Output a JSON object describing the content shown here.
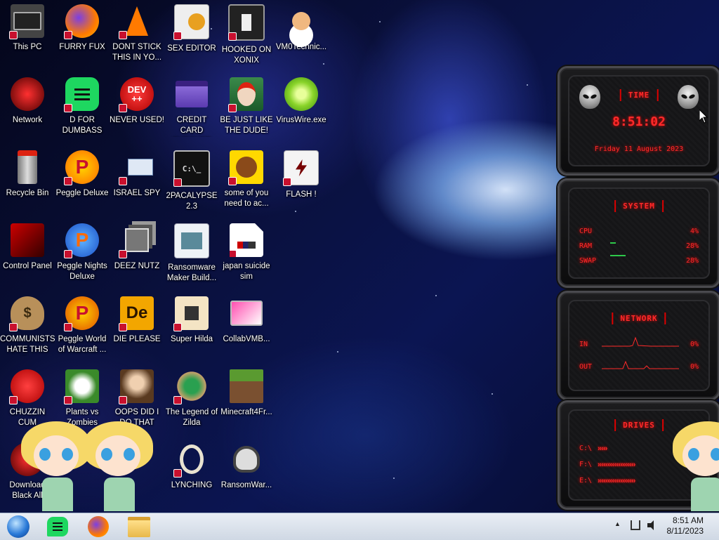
{
  "desktop_icons": [
    {
      "label": "This PC"
    },
    {
      "label": "FURRY FUX"
    },
    {
      "label": "DONT STICK THIS IN YO..."
    },
    {
      "label": "SEX EDITOR"
    },
    {
      "label": "HOOKED ON XONIX"
    },
    {
      "label": "VM0Technic..."
    },
    {
      "label": "Network"
    },
    {
      "label": "D FOR DUMBASS"
    },
    {
      "label": "NEVER USED!"
    },
    {
      "label": "CREDIT CARD CHECKER"
    },
    {
      "label": "BE JUST LIKE THE DUDE!"
    },
    {
      "label": "VirusWire.exe"
    },
    {
      "label": "Recycle Bin"
    },
    {
      "label": "Peggle Deluxe"
    },
    {
      "label": "ISRAEL SPY"
    },
    {
      "label": "2PACALYPSE 2.3"
    },
    {
      "label": "some of you need to ac..."
    },
    {
      "label": "FLASH !"
    },
    {
      "label": "Control Panel"
    },
    {
      "label": "Peggle Nights Deluxe"
    },
    {
      "label": "DEEZ NUTZ"
    },
    {
      "label": "Ransomware Maker Build..."
    },
    {
      "label": "japan suicide sim"
    },
    {
      "label": "COMMUNISTS HATE THIS G..."
    },
    {
      "label": "Peggle World of Warcraft ..."
    },
    {
      "label": "DIE PLEASE"
    },
    {
      "label": "Super Hilda"
    },
    {
      "label": "CollabVMB..."
    },
    {
      "label": "CHUZZIN CUM"
    },
    {
      "label": "Plants vs Zombies"
    },
    {
      "label": "OOPS DID I DO THAT"
    },
    {
      "label": "The Legend of Zilda"
    },
    {
      "label": "Minecraft4Fr..."
    },
    {
      "label": "Download Black All"
    },
    {
      "label": "LYNCHING"
    },
    {
      "label": "RansomWar..."
    }
  ],
  "icon_glyphs": {
    "dev": "DEV",
    "dev_plus": "++",
    "de": "De",
    "prompt": "C:\\_",
    "dollar": "$",
    "peggle": "P"
  },
  "widgets": {
    "time": {
      "title": "TIME",
      "clock": "8:51:02",
      "date": "Friday 11 August 2023"
    },
    "system": {
      "title": "SYSTEM",
      "rows": [
        {
          "label": "CPU",
          "value": "4%"
        },
        {
          "label": "RAM",
          "value": "28%"
        },
        {
          "label": "SWAP",
          "value": "28%"
        }
      ]
    },
    "network": {
      "title": "NETWORK",
      "rows": [
        {
          "label": "IN",
          "value": "0%"
        },
        {
          "label": "OUT",
          "value": "0%"
        }
      ]
    },
    "drives": {
      "title": "DRIVES",
      "rows": [
        {
          "label": "C:\\",
          "fill": 0.2
        },
        {
          "label": "F:\\",
          "fill": 0.85
        },
        {
          "label": "E:\\",
          "fill": 0.85
        }
      ]
    }
  },
  "taskbar": {
    "pinned": [
      "start-orb",
      "spotify",
      "firefox",
      "file-explorer"
    ],
    "tray_arrow": "▲",
    "time": "8:51 AM",
    "date": "8/11/2023"
  },
  "colors": {
    "widget_red": "#ff2a2a",
    "shortcut_badge": "#c8102e"
  }
}
